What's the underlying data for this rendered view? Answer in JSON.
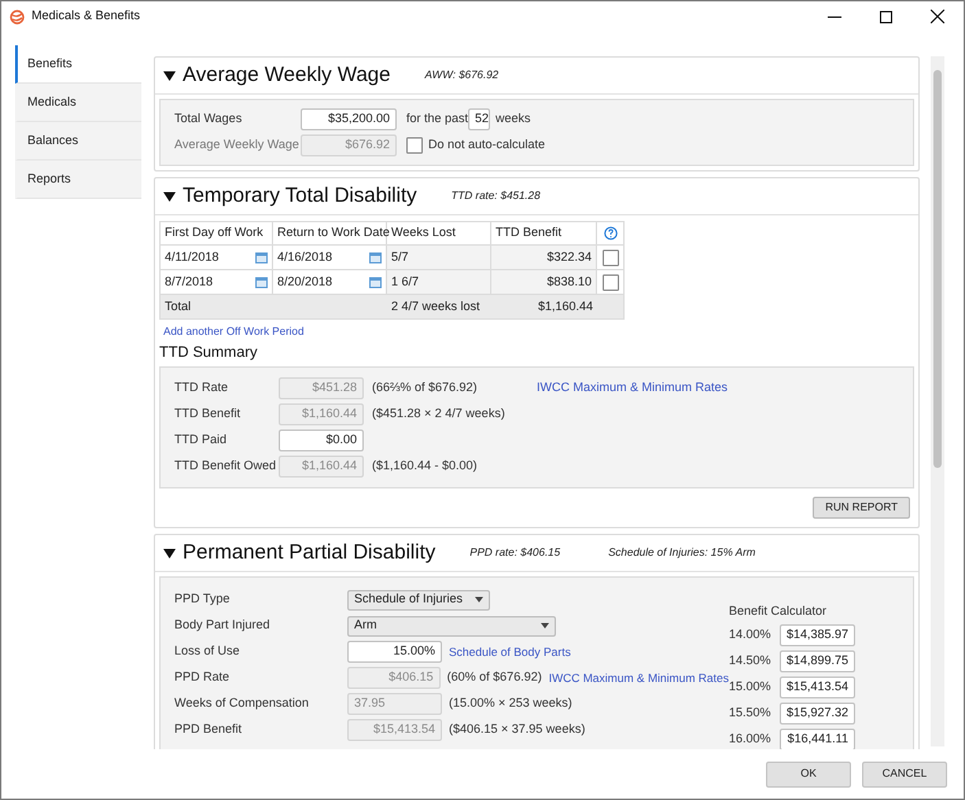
{
  "window": {
    "title": "Medicals & Benefits"
  },
  "sidebar": {
    "items": [
      {
        "label": "Benefits",
        "selected": true
      },
      {
        "label": "Medicals",
        "selected": false
      },
      {
        "label": "Balances",
        "selected": false
      },
      {
        "label": "Reports",
        "selected": false
      }
    ]
  },
  "aww": {
    "title": "Average Weekly Wage",
    "summary": "AWW: $676.92",
    "expanded": true,
    "total_wages": {
      "label": "Total Wages",
      "value": "$35,200.00"
    },
    "past_label": "for the past",
    "weeks_value": "52",
    "weeks_label": "weeks",
    "aww_field": {
      "label": "Average Weekly Wage",
      "value": "$676.92"
    },
    "auto_calc": {
      "label": "Do not auto-calculate",
      "checked": false
    }
  },
  "ttd": {
    "title": "Temporary Total Disability",
    "summary": "TTD rate: $451.28",
    "expanded": true,
    "columns": [
      "First Day off Work",
      "Return to Work Date",
      "Weeks Lost",
      "TTD Benefit"
    ],
    "rows": [
      {
        "first_day": "4/11/2018",
        "return_date": "4/16/2018",
        "weeks_lost": "5/7",
        "benefit": "$322.34",
        "checked": false
      },
      {
        "first_day": "8/7/2018",
        "return_date": "8/20/2018",
        "weeks_lost": "1 6/7",
        "benefit": "$838.10",
        "checked": false
      }
    ],
    "total": {
      "label": "Total",
      "weeks": "2 4/7 weeks lost",
      "benefit": "$1,160.44"
    },
    "add_link": "Add another Off Work Period",
    "summary_title": "TTD Summary",
    "summary_rows": [
      {
        "label": "TTD Rate",
        "value": "$451.28",
        "disabled": true,
        "note": "(66⅔% of $676.92)",
        "link": "IWCC Maximum & Minimum Rates"
      },
      {
        "label": "TTD Benefit",
        "value": "$1,160.44",
        "disabled": true,
        "note": "($451.28 × 2 4/7 weeks)"
      },
      {
        "label": "TTD Paid",
        "value": "$0.00",
        "disabled": false
      },
      {
        "label": "TTD Benefit Owed",
        "value": "$1,160.44",
        "disabled": true,
        "note": "($1,160.44 - $0.00)"
      }
    ],
    "button": "RUN REPORT"
  },
  "ppd": {
    "title": "Permanent Partial Disability",
    "summary": "PPD rate: $406.15",
    "schedule": "Schedule of Injuries: 15% Arm",
    "expanded": true,
    "rows": [
      {
        "kind": "select",
        "label": "PPD Type",
        "value": "Schedule of Injuries"
      },
      {
        "kind": "select",
        "label": "Body Part Injured",
        "value": "Arm"
      },
      {
        "kind": "input",
        "label": "Loss of Use",
        "value": "15.00%",
        "disabled": false,
        "link": "Schedule of Body Parts"
      },
      {
        "kind": "input",
        "label": "PPD Rate",
        "value": "$406.15",
        "disabled": true,
        "note": "(60% of $676.92)",
        "link": "IWCC Maximum & Minimum Rates"
      },
      {
        "kind": "input",
        "label": "Weeks of Compensation",
        "value": "37.95",
        "disabled": true,
        "note": "(15.00% × 253 weeks)"
      },
      {
        "kind": "input",
        "label": "PPD Benefit",
        "value": "$15,413.54",
        "disabled": true,
        "note": "($406.15 × 37.95 weeks)"
      }
    ],
    "calculator": {
      "title": "Benefit Calculator",
      "rows": [
        {
          "percent": "14.00%",
          "value": "$14,385.97"
        },
        {
          "percent": "14.50%",
          "value": "$14,899.75"
        },
        {
          "percent": "15.00%",
          "value": "$15,413.54"
        },
        {
          "percent": "15.50%",
          "value": "$15,927.32"
        },
        {
          "percent": "16.00%",
          "value": "$16,441.11"
        }
      ]
    }
  },
  "buttons": [
    "OK",
    "CANCEL"
  ]
}
